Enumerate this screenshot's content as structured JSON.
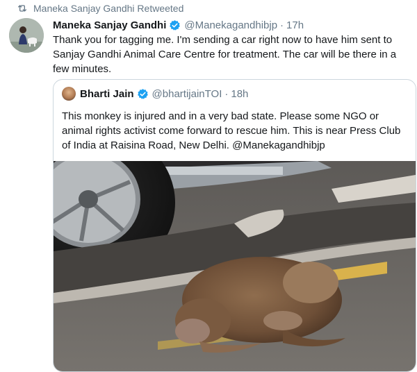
{
  "retweet": {
    "label": "Maneka Sanjay Gandhi Retweeted",
    "icon": "retweet-icon"
  },
  "tweet": {
    "author_name": "Maneka Sanjay Gandhi",
    "handle": "@Manekagandhibjp",
    "separator": "·",
    "time": "17h",
    "text": "Thank you for tagging me. I'm sending a car right now to have him sent to Sanjay Gandhi Animal Care Centre for treatment. The car will be there in a few minutes."
  },
  "quoted": {
    "author_name": "Bharti Jain",
    "handle": "@bhartijainTOI",
    "separator": "·",
    "time": "18h",
    "text": "This monkey is injured and in a very bad state. Please some NGO or animal rights activist come forward to rescue him. This is near Press Club of India at Raisina Road, New Delhi. @Manekagandhibjp"
  },
  "colors": {
    "verified": "#1da1f2",
    "secondary_text": "#657786",
    "border": "#ccd6dd"
  }
}
